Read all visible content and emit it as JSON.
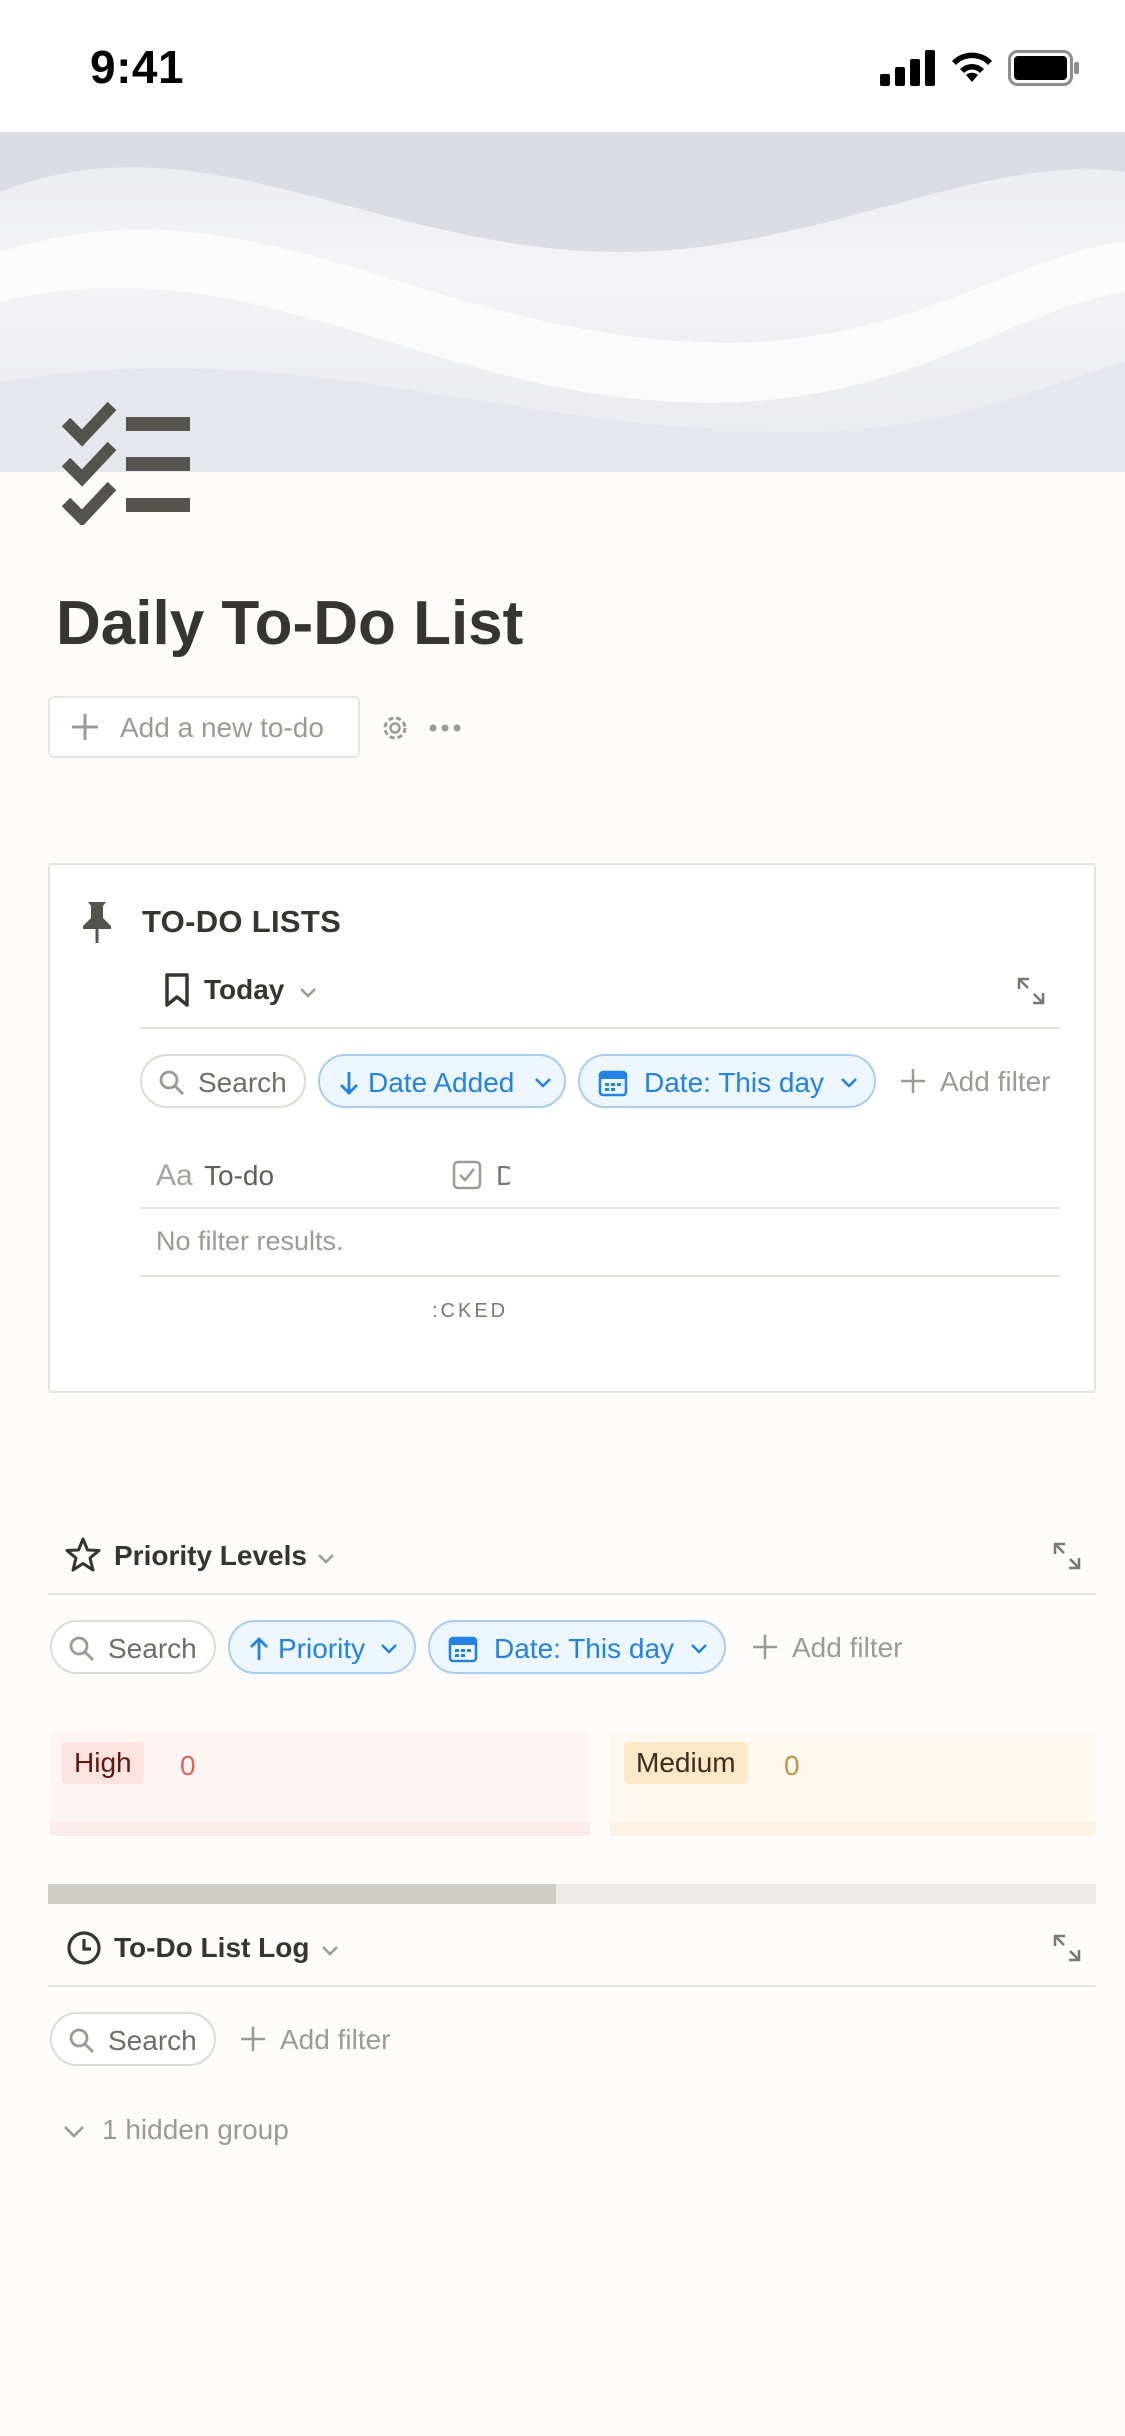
{
  "status_bar": {
    "time": "9:41"
  },
  "page": {
    "title": "Daily To-Do List",
    "add_button_label": "Add a new to-do"
  },
  "todo_lists": {
    "title": "TO-DO LISTS",
    "view_name": "Today",
    "filters": {
      "search": "Search",
      "sort": "Date Added",
      "date_filter": "Date: This day",
      "add_filter": "Add filter"
    },
    "columns": {
      "todo_prefix": "Aa",
      "todo": "To-do",
      "done_fragment": "D"
    },
    "empty_text": "No filter results.",
    "footer_label": ":CKED"
  },
  "priority": {
    "view_name": "Priority Levels",
    "filters": {
      "search": "Search",
      "sort": "Priority",
      "date_filter": "Date: This day",
      "add_filter": "Add filter"
    },
    "groups": [
      {
        "label": "High",
        "count": "0",
        "color": "#e16259"
      },
      {
        "label": "Medium",
        "count": "0",
        "color": "#c29343"
      }
    ]
  },
  "log": {
    "view_name": "To-Do List Log",
    "filters": {
      "search": "Search",
      "add_filter": "Add filter"
    },
    "hidden_groups": "1 hidden group"
  }
}
